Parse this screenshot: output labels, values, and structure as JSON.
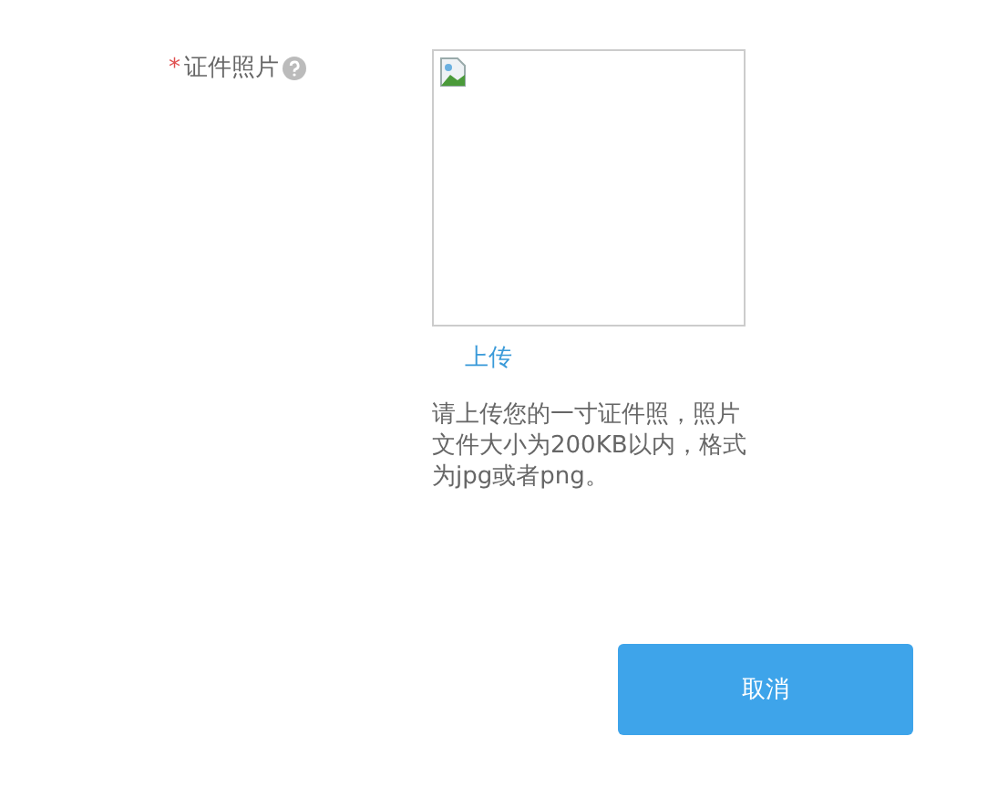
{
  "photo_field": {
    "required_mark": "*",
    "label": "证件照片",
    "upload_link": "上传",
    "hint": "请上传您的一寸证件照，照片文件大小为200KB以内，格式为jpg或者png。"
  },
  "buttons": [
    {
      "label": "取消",
      "kind": "primary"
    }
  ]
}
